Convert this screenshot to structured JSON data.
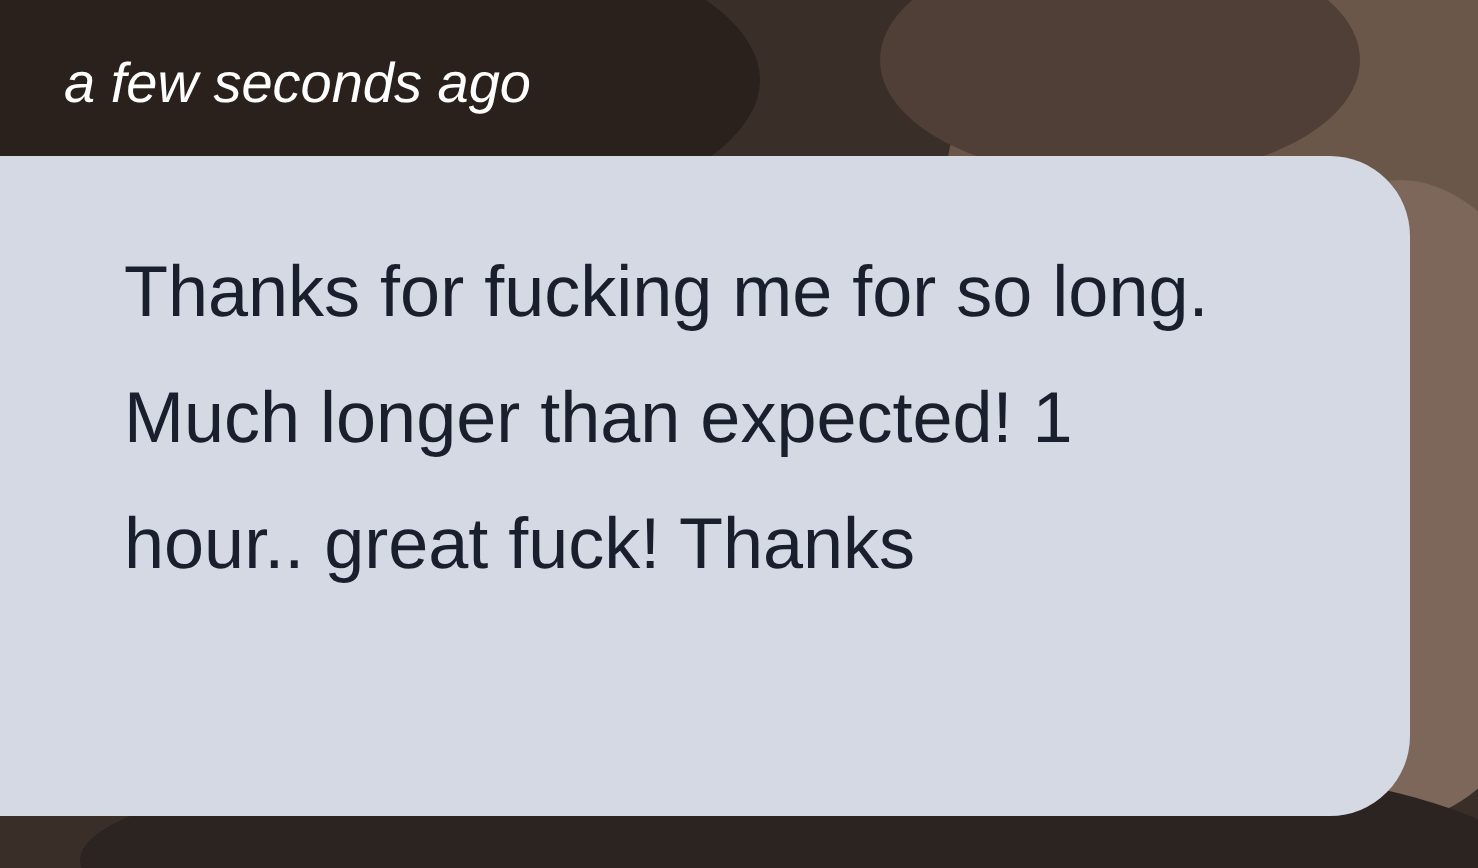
{
  "message": {
    "time": "a few seconds ago",
    "text": "Thanks for fucking me for so long. Much longer than expected! 1 hour.. great fuck! Thanks"
  }
}
